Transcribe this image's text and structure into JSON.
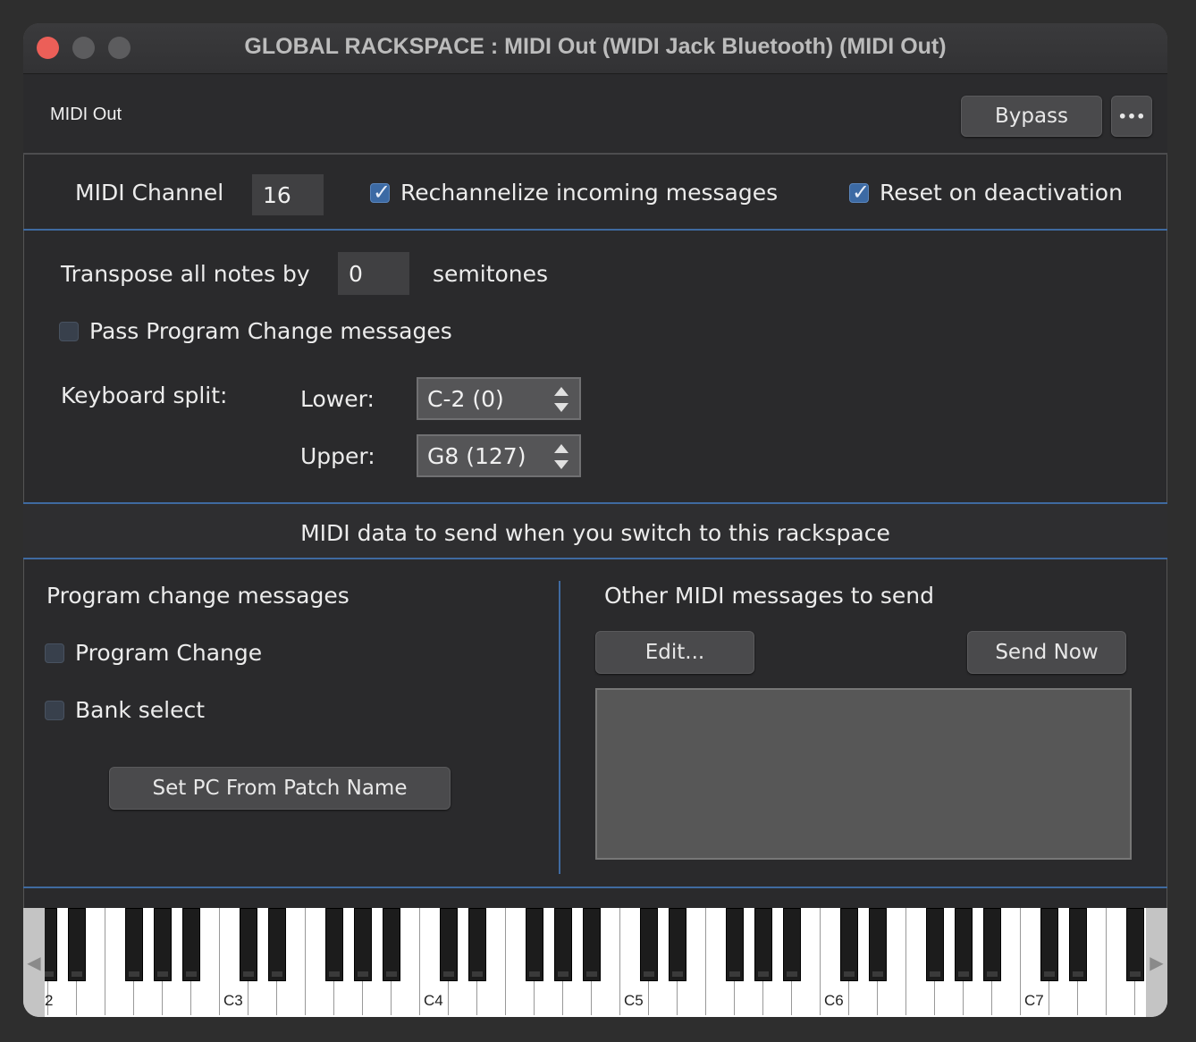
{
  "window": {
    "title": "GLOBAL RACKSPACE : MIDI Out (WIDI Jack Bluetooth) (MIDI Out)"
  },
  "header": {
    "plugin_name": "MIDI Out",
    "bypass_label": "Bypass",
    "more_label": "•••"
  },
  "channel_row": {
    "midi_channel_label": "MIDI Channel",
    "midi_channel_value": "16",
    "rechannelize_label": "Rechannelize incoming messages",
    "rechannelize_checked": true,
    "reset_label": "Reset on deactivation",
    "reset_checked": true
  },
  "transpose": {
    "label": "Transpose all notes by",
    "value": "0",
    "unit": "semitones"
  },
  "pass_pc": {
    "label": "Pass Program Change messages",
    "checked": false
  },
  "keyboard_split": {
    "label": "Keyboard split:",
    "lower_label": "Lower:",
    "lower_value": "C-2 (0)",
    "upper_label": "Upper:",
    "upper_value": "G8 (127)"
  },
  "switch_section": {
    "title": "MIDI data to send when you switch to this rackspace"
  },
  "program_change": {
    "title": "Program change messages",
    "pc_label": "Program Change",
    "pc_checked": false,
    "bank_label": "Bank select",
    "bank_checked": false,
    "set_pc_button": "Set PC From Patch Name"
  },
  "other_midi": {
    "title": "Other MIDI messages to send",
    "edit_button": "Edit...",
    "send_now_button": "Send Now"
  },
  "keyboard": {
    "octave_labels": [
      "2",
      "C3",
      "C4",
      "C5",
      "C6",
      "C7"
    ]
  }
}
